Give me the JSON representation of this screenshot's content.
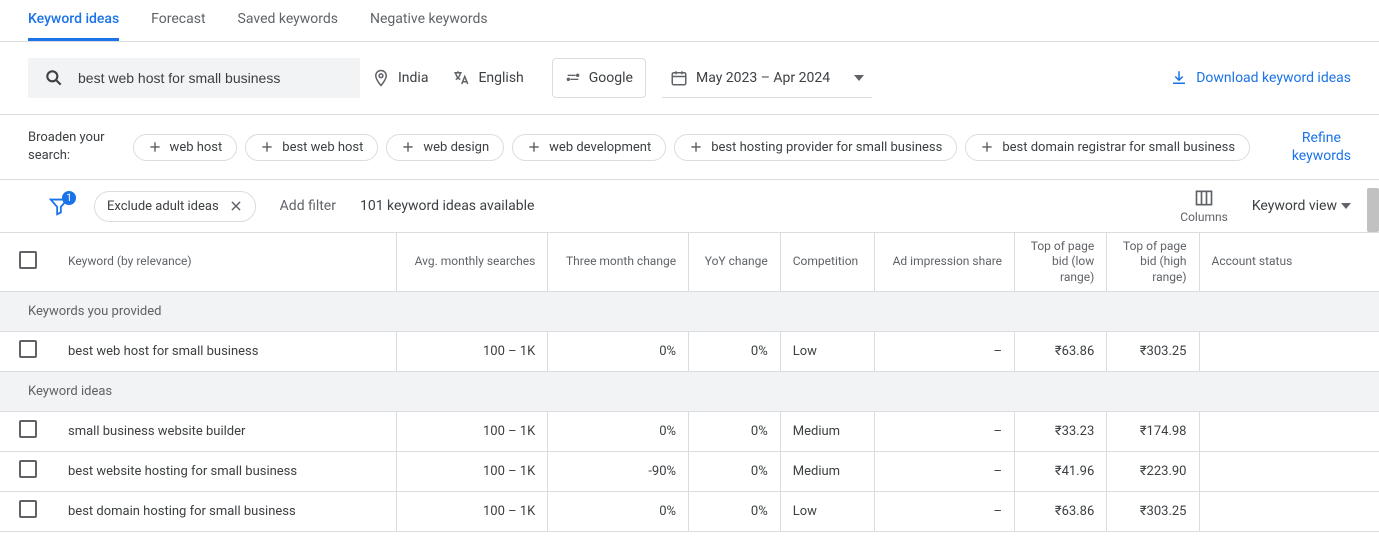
{
  "tabs": [
    "Keyword ideas",
    "Forecast",
    "Saved keywords",
    "Negative keywords"
  ],
  "search": {
    "value": "best web host for small business"
  },
  "selectors": {
    "location": "India",
    "language": "English",
    "network": "Google",
    "date": "May 2023 – Apr 2024"
  },
  "download_label": "Download keyword ideas",
  "broaden": {
    "label_line1": "Broaden your",
    "label_line2": "search:",
    "chips": [
      "web host",
      "best web host",
      "web design",
      "web development",
      "best hosting provider for small business",
      "best domain registrar for small business"
    ]
  },
  "refine": {
    "line1": "Refine",
    "line2": "keywords"
  },
  "filters": {
    "badge": "1",
    "exclude_chip": "Exclude adult ideas",
    "add_filter": "Add filter",
    "available": "101 keyword ideas available",
    "columns_label": "Columns",
    "view_label": "Keyword view"
  },
  "table": {
    "headers": {
      "keyword": "Keyword (by relevance)",
      "avg": "Avg. monthly searches",
      "three_month": "Three month change",
      "yoy": "YoY change",
      "competition": "Competition",
      "ad_impr": "Ad impression share",
      "bid_low_l1": "Top of page",
      "bid_low_l2": "bid (low",
      "bid_low_l3": "range)",
      "bid_high_l1": "Top of page",
      "bid_high_l2": "bid (high",
      "bid_high_l3": "range)",
      "account": "Account status"
    },
    "section1": "Keywords you provided",
    "section2": "Keyword ideas",
    "provided": [
      {
        "keyword": "best web host for small business",
        "avg": "100 – 1K",
        "tmc": "0%",
        "yoy": "0%",
        "comp": "Low",
        "ad": "–",
        "low": "₹63.86",
        "high": "₹303.25",
        "acct": ""
      }
    ],
    "ideas": [
      {
        "keyword": "small business website builder",
        "avg": "100 – 1K",
        "tmc": "0%",
        "yoy": "0%",
        "comp": "Medium",
        "ad": "–",
        "low": "₹33.23",
        "high": "₹174.98",
        "acct": ""
      },
      {
        "keyword": "best website hosting for small business",
        "avg": "100 – 1K",
        "tmc": "-90%",
        "yoy": "0%",
        "comp": "Medium",
        "ad": "–",
        "low": "₹41.96",
        "high": "₹223.90",
        "acct": ""
      },
      {
        "keyword": "best domain hosting for small business",
        "avg": "100 – 1K",
        "tmc": "0%",
        "yoy": "0%",
        "comp": "Low",
        "ad": "–",
        "low": "₹63.86",
        "high": "₹303.25",
        "acct": ""
      }
    ]
  }
}
